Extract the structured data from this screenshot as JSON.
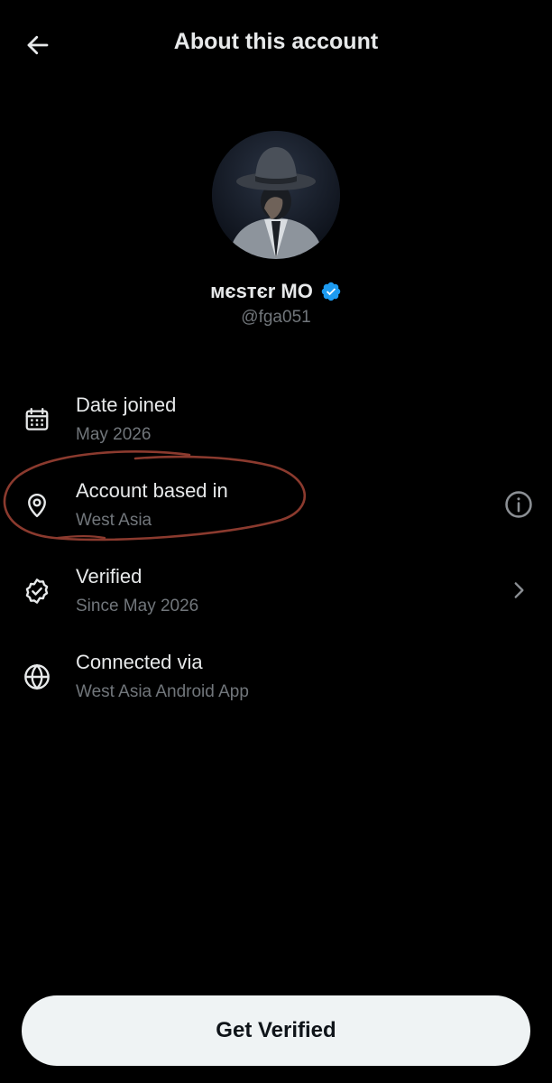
{
  "header": {
    "title": "About this account",
    "back_icon": "arrow-left-icon"
  },
  "profile": {
    "display_name": "мєѕтєr MO",
    "handle": "@fga051",
    "verified": true,
    "badge_color": "#1d9bf0"
  },
  "info_rows": [
    {
      "title": "Date joined",
      "subtitle": "May 2026",
      "icon": "calendar-icon"
    },
    {
      "title": "Account based in",
      "subtitle": "West Asia",
      "icon": "location-pin-icon",
      "action_icon": "info-icon"
    },
    {
      "title": "Verified",
      "subtitle": "Since May 2026",
      "icon": "verified-check-icon",
      "action_icon": "chevron-right-icon"
    },
    {
      "title": "Connected via",
      "subtitle": "West Asia Android App",
      "icon": "globe-icon"
    }
  ],
  "cta": {
    "label": "Get Verified"
  },
  "colors": {
    "background": "#000000",
    "primary_text": "#e7e9ea",
    "secondary_text": "#71767b",
    "annotation_stroke": "#8b3a2e"
  }
}
